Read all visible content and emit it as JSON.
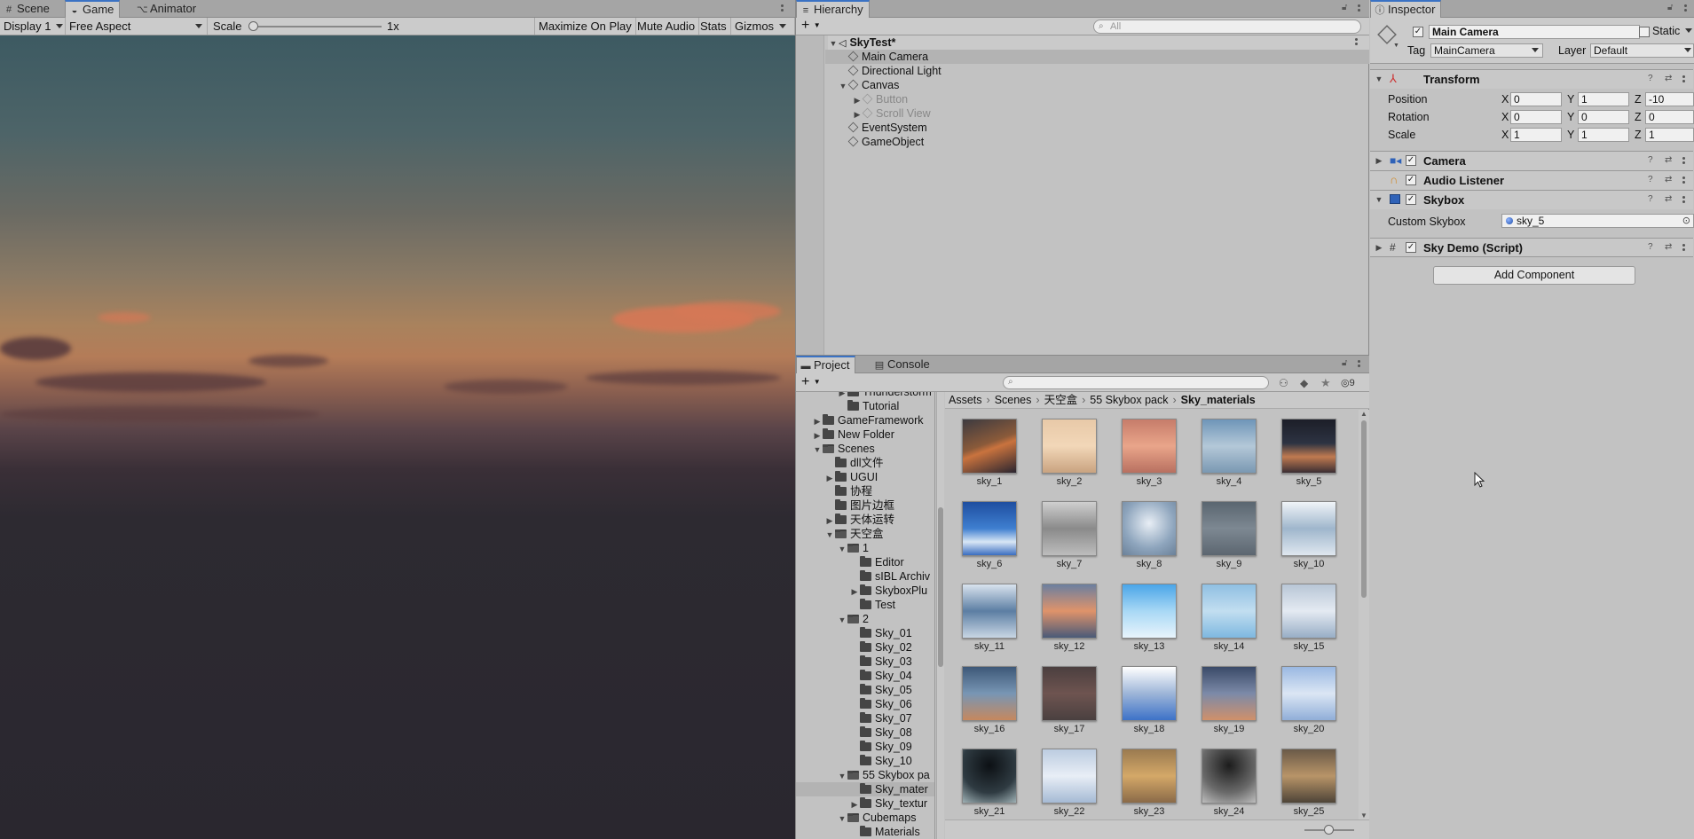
{
  "left_tabs": [
    {
      "label": "Scene",
      "icon": "grid-icon"
    },
    {
      "label": "Game",
      "icon": "gamepad-icon"
    },
    {
      "label": "Animator",
      "icon": "animator-icon"
    }
  ],
  "game_toolbar": {
    "display": "Display 1",
    "aspect": "Free Aspect",
    "scale_label": "Scale",
    "scale_value": "1x",
    "maximize": "Maximize On Play",
    "mute": "Mute Audio",
    "stats": "Stats",
    "gizmos": "Gizmos"
  },
  "hierarchy": {
    "title": "Hierarchy",
    "search_placeholder": "All",
    "add_label": "+",
    "scene_name": "SkyTest*",
    "items": [
      "Main Camera",
      "Directional Light",
      "Canvas",
      "Button",
      "Scroll View",
      "EventSystem",
      "GameObject"
    ]
  },
  "project": {
    "tab_project": "Project",
    "tab_console": "Console",
    "add_label": "+",
    "hidden_count": "9",
    "breadcrumb": [
      "Assets",
      "Scenes",
      "天空盒",
      "55 Skybox pack",
      "Sky_materials"
    ],
    "tree": [
      "Thunderstorm",
      "Tutorial",
      "GameFramework",
      "New Folder",
      "Scenes",
      "dll文件",
      "UGUI",
      "协程",
      "图片边框",
      "天体运转",
      "天空盒",
      "1",
      "Editor",
      "sIBL Archiv",
      "SkyboxPlu",
      "Test",
      "2",
      "Sky_01",
      "Sky_02",
      "Sky_03",
      "Sky_04",
      "Sky_05",
      "Sky_06",
      "Sky_07",
      "Sky_08",
      "Sky_09",
      "Sky_10",
      "55 Skybox pa",
      "Sky_mater",
      "Sky_textur",
      "Cubemaps",
      "Materials"
    ],
    "assets": [
      "sky_1",
      "sky_2",
      "sky_3",
      "sky_4",
      "sky_5",
      "sky_6",
      "sky_7",
      "sky_8",
      "sky_9",
      "sky_10",
      "sky_11",
      "sky_12",
      "sky_13",
      "sky_14",
      "sky_15",
      "sky_16",
      "sky_17",
      "sky_18",
      "sky_19",
      "sky_20",
      "sky_21",
      "sky_22",
      "sky_23",
      "sky_24",
      "sky_25"
    ]
  },
  "inspector": {
    "title": "Inspector",
    "object_name": "Main Camera",
    "static_label": "Static",
    "tag_label": "Tag",
    "tag_value": "MainCamera",
    "layer_label": "Layer",
    "layer_value": "Default",
    "transform": {
      "title": "Transform",
      "position_label": "Position",
      "rotation_label": "Rotation",
      "scale_label": "Scale",
      "position": {
        "x": "0",
        "y": "1",
        "z": "-10"
      },
      "rotation": {
        "x": "0",
        "y": "0",
        "z": "0"
      },
      "scale": {
        "x": "1",
        "y": "1",
        "z": "1"
      }
    },
    "camera_title": "Camera",
    "audio_title": "Audio Listener",
    "skybox_title": "Skybox",
    "custom_skybox_label": "Custom Skybox",
    "custom_skybox_value": "sky_5",
    "script_title": "Sky Demo (Script)",
    "add_component": "Add Component"
  },
  "axis_labels": {
    "x": "X",
    "y": "Y",
    "z": "Z"
  },
  "colors": {
    "accent": "#3a72c4",
    "game_sky_top": "#3d5a62",
    "game_ground": "#2a272f"
  }
}
